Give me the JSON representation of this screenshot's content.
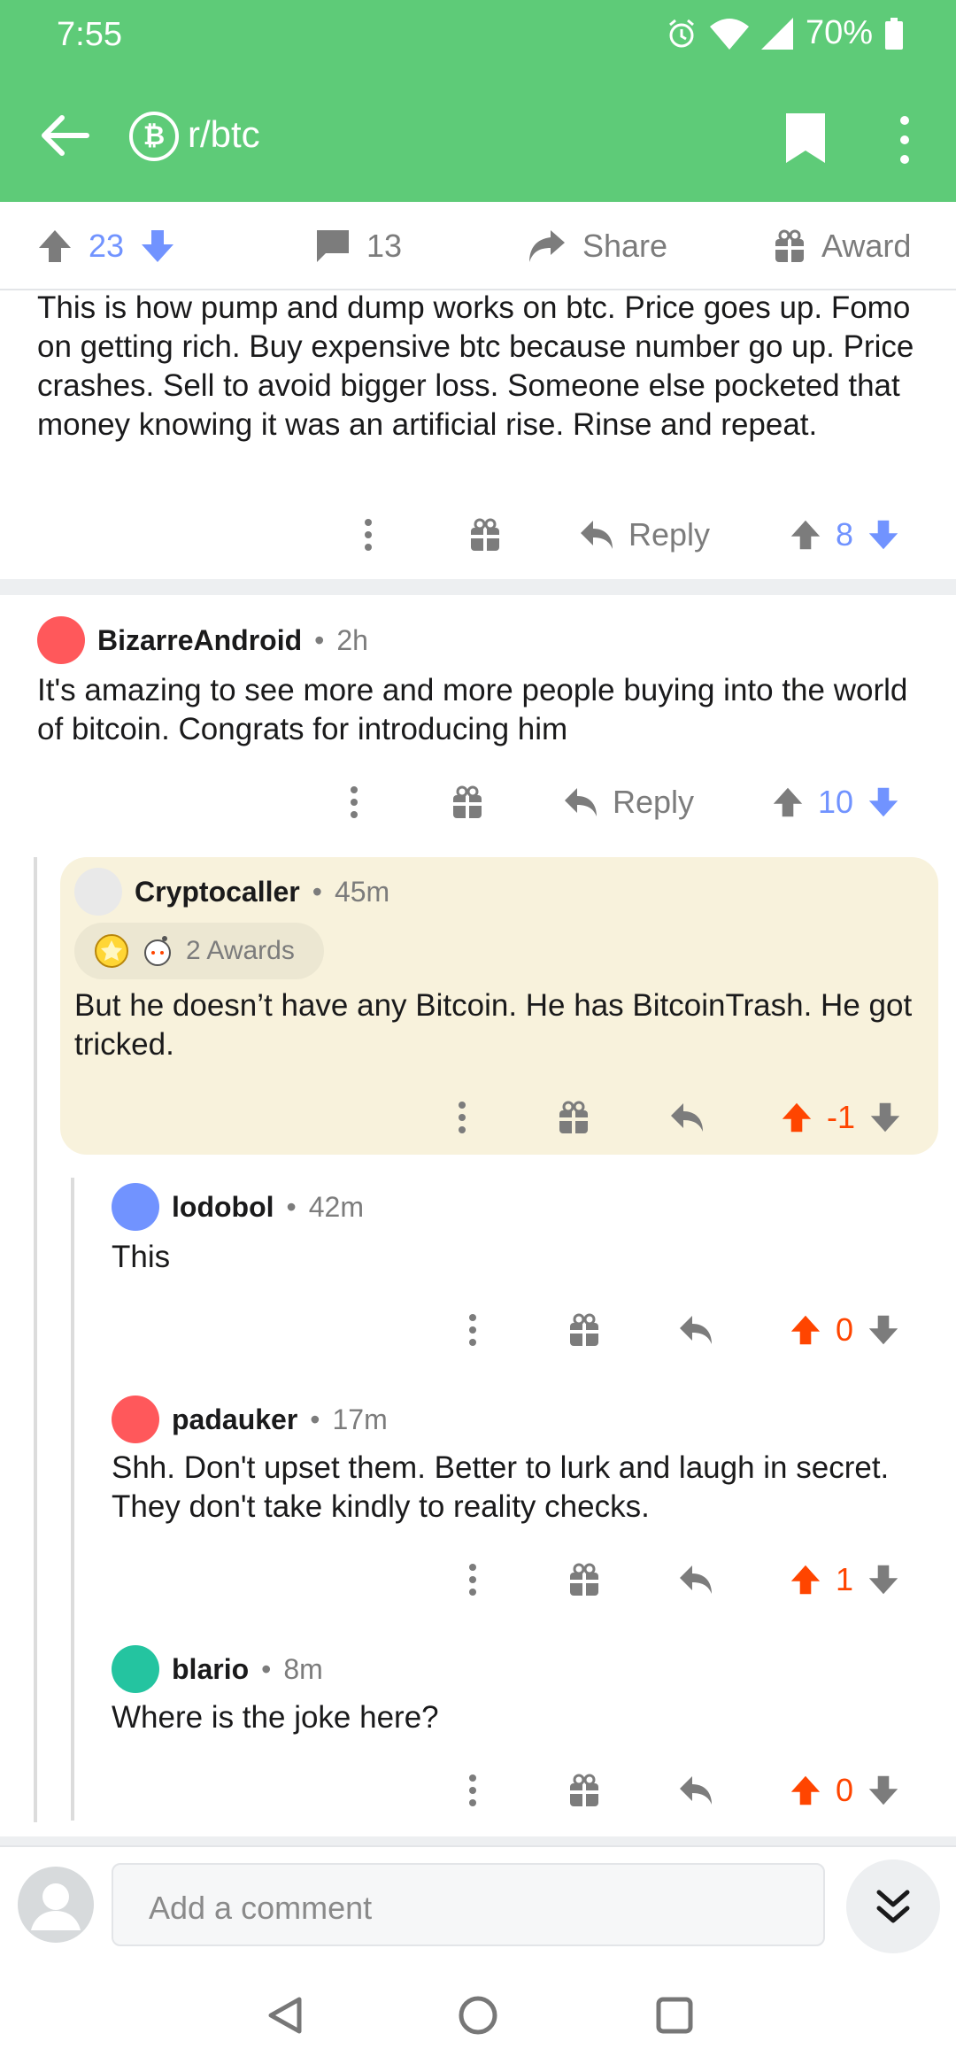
{
  "status": {
    "time": "7:55",
    "battery": "70%"
  },
  "app": {
    "subreddit": "r/btc",
    "subreddit_icon": "₿"
  },
  "post_actions": {
    "votes": "23",
    "comments": "13",
    "share": "Share",
    "award": "Award"
  },
  "comments": [
    {
      "body": "This is how pump and dump works on btc. Price goes up. Fomo on getting rich. Buy expensive btc because number go up. Price crashes. Sell to avoid bigger loss. Someone else pocketed that money knowing it was an artificial rise. Rinse and repeat.",
      "reply": "Reply",
      "score": "8"
    },
    {
      "author": "BizarreAndroid",
      "age": "2h",
      "body": "It's amazing to see more and more people buying into the world of bitcoin. Congrats for introducing him",
      "reply": "Reply",
      "score": "10"
    },
    {
      "author": "Cryptocaller",
      "age": "45m",
      "awards": "2 Awards",
      "body": "But he doesn’t have any Bitcoin. He has BitcoinTrash. He got tricked.",
      "score": "-1"
    },
    {
      "author": "lodobol",
      "age": "42m",
      "body": "This",
      "score": "0"
    },
    {
      "author": "padauker",
      "age": "17m",
      "body": "Shh. Don't upset them. Better to lurk and laugh in secret. They don't take kindly to reality checks.",
      "score": "1"
    },
    {
      "author": "blario",
      "age": "8m",
      "body": "Where is the joke here?",
      "score": "0"
    }
  ],
  "composer": {
    "placeholder": "Add a comment"
  },
  "colors": {
    "header": "#5ecb78",
    "upvote": "#ff4500",
    "blue": "#7193ff",
    "highlight": "#f8f2dc"
  }
}
